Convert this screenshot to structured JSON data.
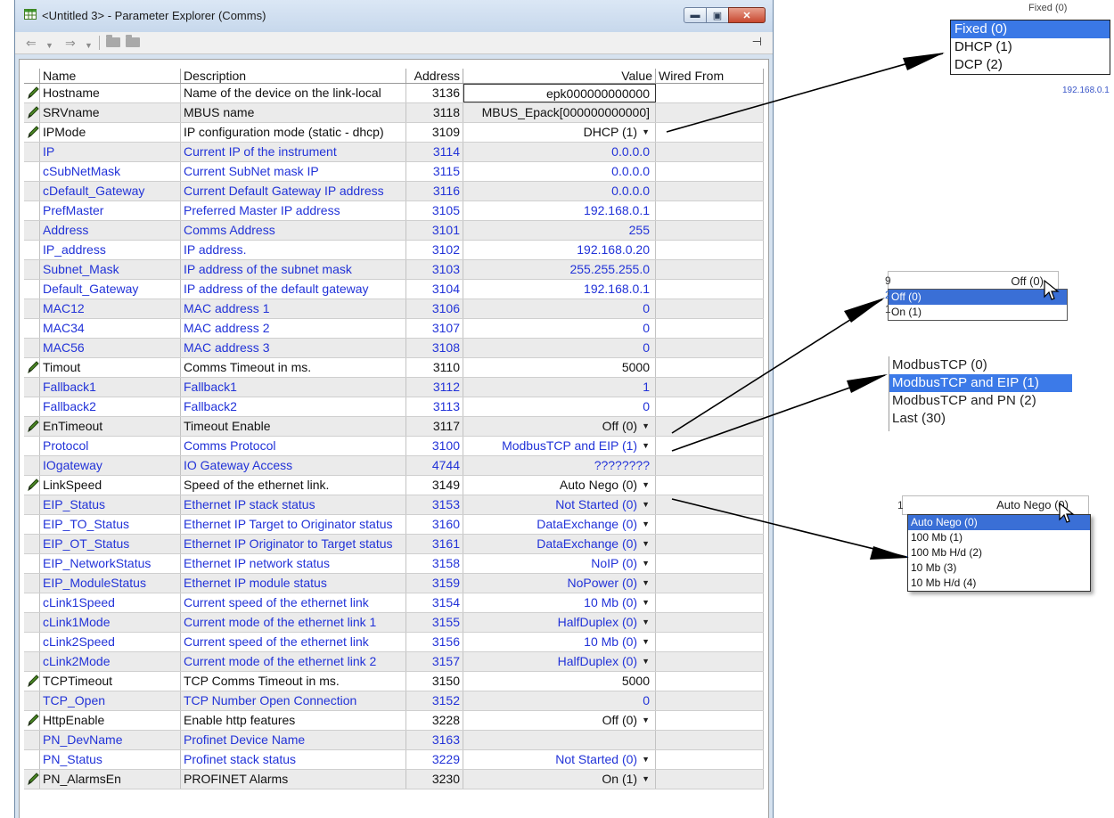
{
  "window": {
    "title": "<Untitled 3> - Parameter Explorer (Comms)",
    "controls": {
      "minimize": "▬",
      "maximize": "▣",
      "close": "✕"
    }
  },
  "toolbar": {
    "back_icon": "arrow-left-icon",
    "forward_icon": "arrow-right-icon",
    "pin_icon": "pin-icon",
    "glyphs": {
      "back": "⇐",
      "drop": "▼",
      "forward": "⇒",
      "pin": "⊣"
    }
  },
  "columns": {
    "name": "Name",
    "description": "Description",
    "address": "Address",
    "value": "Value",
    "wired_from": "Wired From"
  },
  "rows": [
    {
      "name": "Hostname",
      "description": "Name of the device on the link-local",
      "address": "3136",
      "value": "epk000000000000",
      "editable": true,
      "dropdown": false,
      "boxed": true
    },
    {
      "name": "SRVname",
      "description": "MBUS name",
      "address": "3118",
      "value": "MBUS_Epack[000000000000]",
      "editable": true,
      "dropdown": false
    },
    {
      "name": "IPMode",
      "description": "IP configuration mode (static - dhcp)",
      "address": "3109",
      "value": "DHCP (1)",
      "editable": true,
      "dropdown": true
    },
    {
      "name": "IP",
      "description": "Current IP of the instrument",
      "address": "3114",
      "value": "0.0.0.0",
      "editable": false,
      "dropdown": false
    },
    {
      "name": "cSubNetMask",
      "description": "Current SubNet mask IP",
      "address": "3115",
      "value": "0.0.0.0",
      "editable": false,
      "dropdown": false
    },
    {
      "name": "cDefault_Gateway",
      "description": "Current Default Gateway IP address",
      "address": "3116",
      "value": "0.0.0.0",
      "editable": false,
      "dropdown": false
    },
    {
      "name": "PrefMaster",
      "description": "Preferred Master IP address",
      "address": "3105",
      "value": "192.168.0.1",
      "editable": false,
      "dropdown": false
    },
    {
      "name": "Address",
      "description": "Comms Address",
      "address": "3101",
      "value": "255",
      "editable": false,
      "dropdown": false
    },
    {
      "name": "IP_address",
      "description": "IP address.",
      "address": "3102",
      "value": "192.168.0.20",
      "editable": false,
      "dropdown": false
    },
    {
      "name": "Subnet_Mask",
      "description": "IP address of the subnet mask",
      "address": "3103",
      "value": "255.255.255.0",
      "editable": false,
      "dropdown": false
    },
    {
      "name": "Default_Gateway",
      "description": "IP address of the default gateway",
      "address": "3104",
      "value": "192.168.0.1",
      "editable": false,
      "dropdown": false
    },
    {
      "name": "MAC12",
      "description": "MAC address 1",
      "address": "3106",
      "value": "0",
      "editable": false,
      "dropdown": false
    },
    {
      "name": "MAC34",
      "description": "MAC address 2",
      "address": "3107",
      "value": "0",
      "editable": false,
      "dropdown": false
    },
    {
      "name": "MAC56",
      "description": "MAC address 3",
      "address": "3108",
      "value": "0",
      "editable": false,
      "dropdown": false
    },
    {
      "name": "Timout",
      "description": "Comms Timeout in ms.",
      "address": "3110",
      "value": "5000",
      "editable": true,
      "dropdown": false
    },
    {
      "name": "Fallback1",
      "description": "Fallback1",
      "address": "3112",
      "value": "1",
      "editable": false,
      "dropdown": false
    },
    {
      "name": "Fallback2",
      "description": "Fallback2",
      "address": "3113",
      "value": "0",
      "editable": false,
      "dropdown": false
    },
    {
      "name": "EnTimeout",
      "description": "Timeout Enable",
      "address": "3117",
      "value": "Off (0)",
      "editable": true,
      "dropdown": true
    },
    {
      "name": "Protocol",
      "description": "Comms Protocol",
      "address": "3100",
      "value": "ModbusTCP and EIP (1)",
      "editable": false,
      "dropdown": true
    },
    {
      "name": "IOgateway",
      "description": "IO Gateway Access",
      "address": "4744",
      "value": "????????",
      "editable": false,
      "dropdown": false
    },
    {
      "name": "LinkSpeed",
      "description": "Speed of the ethernet link.",
      "address": "3149",
      "value": "Auto Nego (0)",
      "editable": true,
      "dropdown": true
    },
    {
      "name": "EIP_Status",
      "description": "Ethernet IP stack status",
      "address": "3153",
      "value": "Not Started (0)",
      "editable": false,
      "dropdown": true
    },
    {
      "name": "EIP_TO_Status",
      "description": "Ethernet IP Target to Originator status",
      "address": "3160",
      "value": "DataExchange (0)",
      "editable": false,
      "dropdown": true
    },
    {
      "name": "EIP_OT_Status",
      "description": "Ethernet IP  Originator to Target status",
      "address": "3161",
      "value": "DataExchange (0)",
      "editable": false,
      "dropdown": true
    },
    {
      "name": "EIP_NetworkStatus",
      "description": "Ethernet IP network status",
      "address": "3158",
      "value": "NoIP (0)",
      "editable": false,
      "dropdown": true
    },
    {
      "name": "EIP_ModuleStatus",
      "description": "Ethernet IP module status",
      "address": "3159",
      "value": "NoPower (0)",
      "editable": false,
      "dropdown": true
    },
    {
      "name": "cLink1Speed",
      "description": "Current speed of the ethernet link",
      "address": "3154",
      "value": "10 Mb (0)",
      "editable": false,
      "dropdown": true
    },
    {
      "name": "cLink1Mode",
      "description": "Current mode of the ethernet link 1",
      "address": "3155",
      "value": "HalfDuplex (0)",
      "editable": false,
      "dropdown": true
    },
    {
      "name": "cLink2Speed",
      "description": "Current speed of the ethernet link",
      "address": "3156",
      "value": "10 Mb (0)",
      "editable": false,
      "dropdown": true
    },
    {
      "name": "cLink2Mode",
      "description": "Current mode of the ethernet link 2",
      "address": "3157",
      "value": "HalfDuplex (0)",
      "editable": false,
      "dropdown": true
    },
    {
      "name": "TCPTimeout",
      "description": "TCP Comms Timeout in ms.",
      "address": "3150",
      "value": "5000",
      "editable": true,
      "dropdown": false
    },
    {
      "name": "TCP_Open",
      "description": "TCP Number Open Connection",
      "address": "3152",
      "value": "0",
      "editable": false,
      "dropdown": false
    },
    {
      "name": "HttpEnable",
      "description": "Enable http features",
      "address": "3228",
      "value": "Off (0)",
      "editable": true,
      "dropdown": true
    },
    {
      "name": "PN_DevName",
      "description": "Profinet Device Name",
      "address": "3163",
      "value": "",
      "editable": false,
      "dropdown": false
    },
    {
      "name": "PN_Status",
      "description": "Profinet stack status",
      "address": "3229",
      "value": "Not Started (0)",
      "editable": false,
      "dropdown": true
    },
    {
      "name": "PN_AlarmsEn",
      "description": "PROFINET Alarms",
      "address": "3230",
      "value": "On (1)",
      "editable": true,
      "dropdown": true
    }
  ],
  "popups": {
    "ipmode": {
      "stub_top": "Fixed (0)",
      "stub_bottom": "192.168.0.1",
      "options": [
        "Fixed (0)",
        "DHCP (1)",
        "DCP (2)"
      ],
      "selected": 0
    },
    "entimeout": {
      "left_digits": "9\n2\n1",
      "current": "Off (0)",
      "options": [
        "Off (0)",
        "On (1)"
      ],
      "selected": 0
    },
    "protocol": {
      "options": [
        "ModbusTCP (0)",
        "ModbusTCP and EIP (1)",
        "ModbusTCP and PN (2)",
        "Last (30)"
      ],
      "selected": 1
    },
    "linkspeed": {
      "left_digit": "1",
      "current": "Auto Nego (0)",
      "options": [
        "Auto Nego (0)",
        "100 Mb (1)",
        "100 Mb H/d (2)",
        "10  Mb (3)",
        "10 Mb H/d (4)"
      ],
      "selected": 0
    }
  },
  "colors": {
    "readonly_text": "#2233d8",
    "selection": "#3a78e6",
    "pencil": "#3f7a1f"
  }
}
